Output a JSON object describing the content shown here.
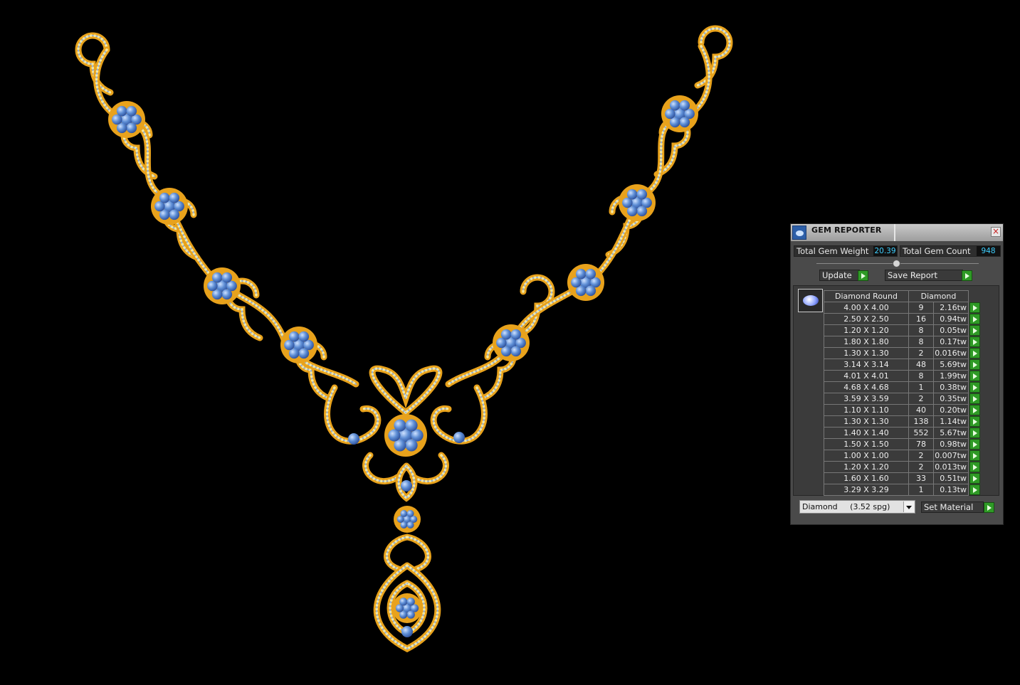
{
  "panel": {
    "title": "GEM REPORTER",
    "close_glyph": "×",
    "total_weight_label": "Total Gem Weight",
    "total_weight_value": "20.39",
    "total_count_label": "Total Gem Count",
    "total_count_value": "948",
    "update_label": "Update",
    "save_report_label": "Save Report",
    "table_headers": [
      "Diamond Round",
      "Diamond"
    ],
    "rows": [
      {
        "size": "4.00 X 4.00",
        "count": "9",
        "weight": "2.16tw"
      },
      {
        "size": "2.50 X 2.50",
        "count": "16",
        "weight": "0.94tw"
      },
      {
        "size": "1.20 X 1.20",
        "count": "8",
        "weight": "0.05tw"
      },
      {
        "size": "1.80 X 1.80",
        "count": "8",
        "weight": "0.17tw"
      },
      {
        "size": "1.30 X 1.30",
        "count": "2",
        "weight": "0.016tw"
      },
      {
        "size": "3.14 X 3.14",
        "count": "48",
        "weight": "5.69tw"
      },
      {
        "size": "4.01 X 4.01",
        "count": "8",
        "weight": "1.99tw"
      },
      {
        "size": "4.68 X 4.68",
        "count": "1",
        "weight": "0.38tw"
      },
      {
        "size": "3.59 X 3.59",
        "count": "2",
        "weight": "0.35tw"
      },
      {
        "size": "1.10 X 1.10",
        "count": "40",
        "weight": "0.20tw"
      },
      {
        "size": "1.30 X 1.30",
        "count": "138",
        "weight": "1.14tw"
      },
      {
        "size": "1.40 X 1.40",
        "count": "552",
        "weight": "5.67tw"
      },
      {
        "size": "1.50 X 1.50",
        "count": "78",
        "weight": "0.98tw"
      },
      {
        "size": "1.00 X 1.00",
        "count": "2",
        "weight": "0.007tw"
      },
      {
        "size": "1.20 X 1.20",
        "count": "2",
        "weight": "0.013tw"
      },
      {
        "size": "1.60 X 1.60",
        "count": "33",
        "weight": "0.51tw"
      },
      {
        "size": "3.29 X 3.29",
        "count": "1",
        "weight": "0.13tw"
      }
    ],
    "material_value": "Diamond     (3.52 spg)",
    "set_material_label": "Set Material"
  },
  "colors": {
    "viewport_bg": "#000000",
    "metal": "#e8a21c",
    "metal_light": "#f5e9a0",
    "stone": "#5f8fd6",
    "accent_value": "#3fd0ff",
    "action_green": "#2f9a26"
  },
  "icons": {
    "app": "gem-reporter-icon",
    "close": "close-icon",
    "go": "play-arrow-icon",
    "gem_preview": "round-gem-icon",
    "dropdown": "chevron-down-icon"
  }
}
